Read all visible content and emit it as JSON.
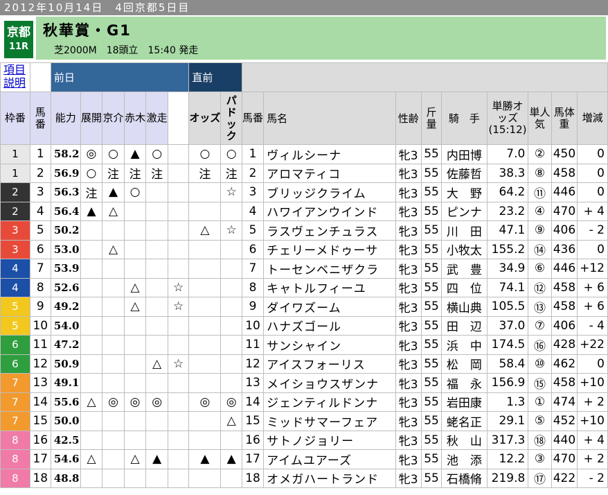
{
  "header": {
    "date_line": "2012年10月14日　4回京都5日目",
    "venue": "京都",
    "race_no": "11R",
    "race_name": "秋華賞・G1",
    "race_info": "芝2000M　18頭立　15:40 発走"
  },
  "columns": {
    "help": "項目説明",
    "group_prev": "前日",
    "group_final": "直前",
    "waku": "枠番",
    "umaban": "馬番",
    "ability": "能力",
    "tenkai": "展開",
    "kyosuke": "京介",
    "akagi": "赤木",
    "gekiso": "激走",
    "odds": "オッズ",
    "paddock": "パドック",
    "umaban2": "馬番",
    "horse_name": "馬名",
    "sex_age": "性齢",
    "weight_carried": "斤量",
    "jockey": "騎　手",
    "win_odds": "単勝オッズ(15:12)",
    "popularity": "単人気",
    "body_weight": "馬体重",
    "change": "増減"
  },
  "rows": [
    {
      "waku": "1",
      "num": "1",
      "ability": "58.2",
      "tenkai": "◎",
      "kyosuke": "○",
      "akagi": "▲",
      "gekiso_a": "○",
      "gekiso": "",
      "odds": "○",
      "paddock": "○",
      "name": "ヴィルシーナ",
      "sexage": "牝3",
      "kin": "55",
      "jockey": "内田博",
      "win": "7.0",
      "pop": "②",
      "bw": "450",
      "chg": "0"
    },
    {
      "waku": "1",
      "num": "2",
      "ability": "56.9",
      "tenkai": "○",
      "kyosuke": "注",
      "akagi": "注",
      "gekiso_a": "注",
      "gekiso": "",
      "odds": "注",
      "paddock": "注",
      "name": "アロマティコ",
      "sexage": "牝3",
      "kin": "55",
      "jockey": "佐藤哲",
      "win": "38.3",
      "pop": "⑧",
      "bw": "458",
      "chg": "0"
    },
    {
      "waku": "2",
      "num": "3",
      "ability": "56.3",
      "tenkai": "注",
      "kyosuke": "▲",
      "akagi": "○",
      "gekiso_a": "",
      "gekiso": "",
      "odds": "",
      "paddock": "☆",
      "name": "ブリッジクライム",
      "sexage": "牝3",
      "kin": "55",
      "jockey": "大　野",
      "win": "64.2",
      "pop": "⑪",
      "bw": "446",
      "chg": "0"
    },
    {
      "waku": "2",
      "num": "4",
      "ability": "56.4",
      "tenkai": "▲",
      "kyosuke": "△",
      "akagi": "",
      "gekiso_a": "",
      "gekiso": "",
      "odds": "",
      "paddock": "",
      "name": "ハワイアンウインド",
      "sexage": "牝3",
      "kin": "55",
      "jockey": "ピンナ",
      "win": "23.2",
      "pop": "④",
      "bw": "470",
      "chg": "+ 4"
    },
    {
      "waku": "3",
      "num": "5",
      "ability": "50.2",
      "tenkai": "",
      "kyosuke": "",
      "akagi": "",
      "gekiso_a": "",
      "gekiso": "",
      "odds": "△",
      "paddock": "☆",
      "name": "ラスヴェンチュラス",
      "sexage": "牝3",
      "kin": "55",
      "jockey": "川　田",
      "win": "47.1",
      "pop": "⑨",
      "bw": "406",
      "chg": "- 2"
    },
    {
      "waku": "3",
      "num": "6",
      "ability": "53.0",
      "tenkai": "",
      "kyosuke": "△",
      "akagi": "",
      "gekiso_a": "",
      "gekiso": "",
      "odds": "",
      "paddock": "",
      "name": "チェリーメドゥーサ",
      "sexage": "牝3",
      "kin": "55",
      "jockey": "小牧太",
      "win": "155.2",
      "pop": "⑭",
      "bw": "436",
      "chg": "0"
    },
    {
      "waku": "4",
      "num": "7",
      "ability": "53.9",
      "tenkai": "",
      "kyosuke": "",
      "akagi": "",
      "gekiso_a": "",
      "gekiso": "",
      "odds": "",
      "paddock": "",
      "name": "トーセンベニザクラ",
      "sexage": "牝3",
      "kin": "55",
      "jockey": "武　豊",
      "win": "34.9",
      "pop": "⑥",
      "bw": "446",
      "chg": "+12"
    },
    {
      "waku": "4",
      "num": "8",
      "ability": "52.6",
      "tenkai": "",
      "kyosuke": "",
      "akagi": "△",
      "gekiso_a": "",
      "gekiso": "☆",
      "odds": "",
      "paddock": "",
      "name": "キャトルフィーユ",
      "sexage": "牝3",
      "kin": "55",
      "jockey": "四　位",
      "win": "74.1",
      "pop": "⑫",
      "bw": "458",
      "chg": "+ 6"
    },
    {
      "waku": "5",
      "num": "9",
      "ability": "49.2",
      "tenkai": "",
      "kyosuke": "",
      "akagi": "△",
      "gekiso_a": "",
      "gekiso": "☆",
      "odds": "",
      "paddock": "",
      "name": "ダイワズーム",
      "sexage": "牝3",
      "kin": "55",
      "jockey": "横山典",
      "win": "105.5",
      "pop": "⑬",
      "bw": "458",
      "chg": "+ 6"
    },
    {
      "waku": "5",
      "num": "10",
      "ability": "54.0",
      "tenkai": "",
      "kyosuke": "",
      "akagi": "",
      "gekiso_a": "",
      "gekiso": "",
      "odds": "",
      "paddock": "",
      "name": "ハナズゴール",
      "sexage": "牝3",
      "kin": "55",
      "jockey": "田　辺",
      "win": "37.0",
      "pop": "⑦",
      "bw": "406",
      "chg": "- 4"
    },
    {
      "waku": "6",
      "num": "11",
      "ability": "47.2",
      "tenkai": "",
      "kyosuke": "",
      "akagi": "",
      "gekiso_a": "",
      "gekiso": "",
      "odds": "",
      "paddock": "",
      "name": "サンシャイン",
      "sexage": "牝3",
      "kin": "55",
      "jockey": "浜　中",
      "win": "174.5",
      "pop": "⑯",
      "bw": "428",
      "chg": "+22"
    },
    {
      "waku": "6",
      "num": "12",
      "ability": "50.9",
      "tenkai": "",
      "kyosuke": "",
      "akagi": "",
      "gekiso_a": "△",
      "gekiso": "☆",
      "odds": "",
      "paddock": "",
      "name": "アイスフォーリス",
      "sexage": "牝3",
      "kin": "55",
      "jockey": "松　岡",
      "win": "58.4",
      "pop": "⑩",
      "bw": "462",
      "chg": "0"
    },
    {
      "waku": "7",
      "num": "13",
      "ability": "49.1",
      "tenkai": "",
      "kyosuke": "",
      "akagi": "",
      "gekiso_a": "",
      "gekiso": "",
      "odds": "",
      "paddock": "",
      "name": "メイショウスザンナ",
      "sexage": "牝3",
      "kin": "55",
      "jockey": "福　永",
      "win": "156.9",
      "pop": "⑮",
      "bw": "458",
      "chg": "+10"
    },
    {
      "waku": "7",
      "num": "14",
      "ability": "55.6",
      "tenkai": "△",
      "kyosuke": "◎",
      "akagi": "◎",
      "gekiso_a": "◎",
      "gekiso": "",
      "odds": "◎",
      "paddock": "◎",
      "name": "ジェンティルドンナ",
      "sexage": "牝3",
      "kin": "55",
      "jockey": "岩田康",
      "win": "1.3",
      "pop": "①",
      "bw": "474",
      "chg": "+ 2"
    },
    {
      "waku": "7",
      "num": "15",
      "ability": "50.0",
      "tenkai": "",
      "kyosuke": "",
      "akagi": "",
      "gekiso_a": "",
      "gekiso": "",
      "odds": "",
      "paddock": "△",
      "name": "ミッドサマーフェア",
      "sexage": "牝3",
      "kin": "55",
      "jockey": "蛯名正",
      "win": "29.1",
      "pop": "⑤",
      "bw": "452",
      "chg": "+10"
    },
    {
      "waku": "8",
      "num": "16",
      "ability": "42.5",
      "tenkai": "",
      "kyosuke": "",
      "akagi": "",
      "gekiso_a": "",
      "gekiso": "",
      "odds": "",
      "paddock": "",
      "name": "サトノジョリー",
      "sexage": "牝3",
      "kin": "55",
      "jockey": "秋　山",
      "win": "317.3",
      "pop": "⑱",
      "bw": "440",
      "chg": "+ 4"
    },
    {
      "waku": "8",
      "num": "17",
      "ability": "54.6",
      "tenkai": "△",
      "kyosuke": "",
      "akagi": "△",
      "gekiso_a": "▲",
      "gekiso": "",
      "odds": "▲",
      "paddock": "▲",
      "name": "アイムユアーズ",
      "sexage": "牝3",
      "kin": "55",
      "jockey": "池　添",
      "win": "12.2",
      "pop": "③",
      "bw": "470",
      "chg": "+ 2"
    },
    {
      "waku": "8",
      "num": "18",
      "ability": "48.8",
      "tenkai": "",
      "kyosuke": "",
      "akagi": "",
      "gekiso_a": "",
      "gekiso": "",
      "odds": "",
      "paddock": "",
      "name": "オメガハートランド",
      "sexage": "牝3",
      "kin": "55",
      "jockey": "石橋脩",
      "win": "219.8",
      "pop": "⑰",
      "bw": "422",
      "chg": "- 2"
    }
  ],
  "waku_colors": {
    "1": {
      "bg": "#e8e8e8",
      "fg": "#000000"
    },
    "2": {
      "bg": "#333333",
      "fg": "#ffffff"
    },
    "3": {
      "bg": "#e84a3a",
      "fg": "#ffffff"
    },
    "4": {
      "bg": "#1b4fa8",
      "fg": "#ffffff"
    },
    "5": {
      "bg": "#f2c81e",
      "fg": "#ffffff"
    },
    "6": {
      "bg": "#2e9e3e",
      "fg": "#ffffff"
    },
    "7": {
      "bg": "#f29a2e",
      "fg": "#ffffff"
    },
    "8": {
      "bg": "#f07aa8",
      "fg": "#ffffff"
    }
  }
}
